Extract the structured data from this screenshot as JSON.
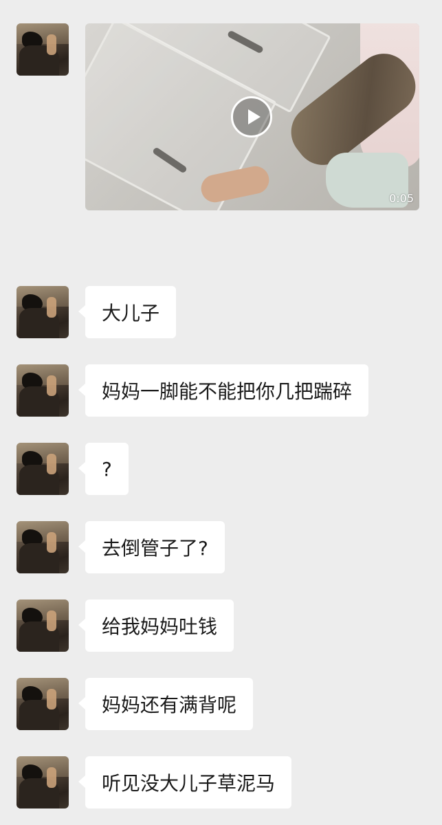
{
  "video_message": {
    "duration": "0:05"
  },
  "messages": [
    {
      "text": "大儿子"
    },
    {
      "text": "妈妈一脚能不能把你几把踹碎"
    },
    {
      "text": "?"
    },
    {
      "text": "去倒管子了?"
    },
    {
      "text": "给我妈妈吐钱"
    },
    {
      "text": "妈妈还有满背呢"
    },
    {
      "text": "听见没大儿子草泥马"
    }
  ]
}
